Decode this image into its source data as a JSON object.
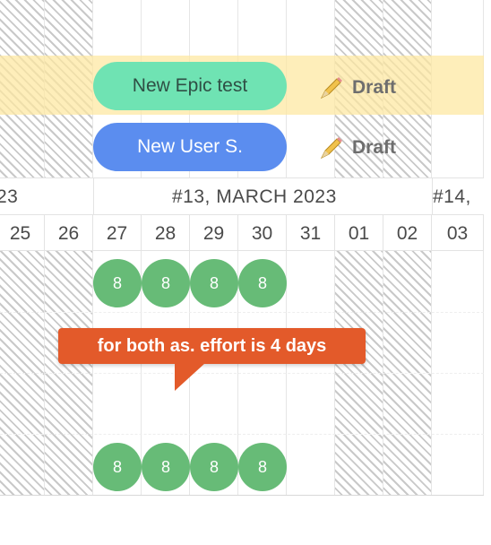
{
  "tasks": [
    {
      "name": "New Epic test",
      "status": "Draft",
      "pill_color": "#6fe3b3",
      "status_icon": "pencil-icon"
    },
    {
      "name": "New User S.",
      "status": "Draft",
      "pill_color": "#5b8def",
      "status_icon": "pencil-icon"
    }
  ],
  "timeline": {
    "week_left": "23",
    "week_current": "#13, MARCH 2023",
    "week_right": "#14,",
    "days": [
      "25",
      "26",
      "27",
      "28",
      "29",
      "30",
      "31",
      "01",
      "02",
      "03"
    ],
    "non_working_days": [
      "25",
      "26",
      "01",
      "02"
    ]
  },
  "effort_rows": [
    {
      "values": [
        "8",
        "8",
        "8",
        "8"
      ]
    },
    {
      "values": [
        "8",
        "8",
        "8",
        "8"
      ]
    }
  ],
  "annotation": {
    "text": "for both as. effort is 4 days",
    "color": "#e35a2a"
  },
  "colors": {
    "effort_dot": "#67bb77",
    "epic_band": "#fde8a0"
  }
}
